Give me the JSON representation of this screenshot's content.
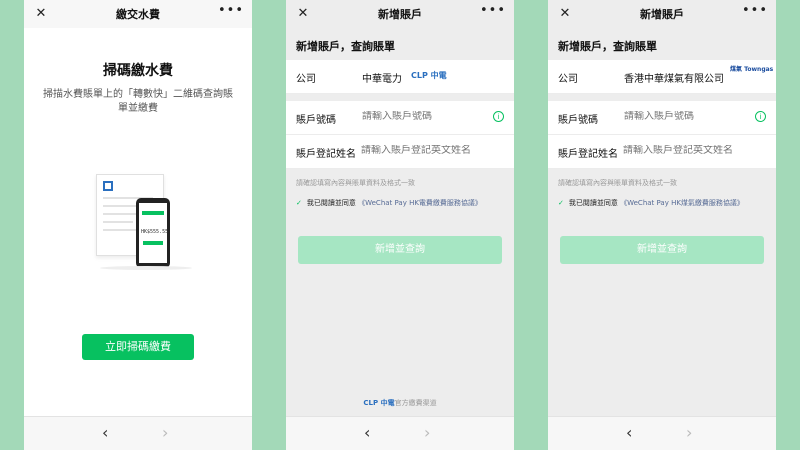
{
  "screen1": {
    "title": "繳交水費",
    "heading": "掃碼繳水費",
    "desc": "掃描水費賬單上的「轉數快」二維碼查詢賬單並繳費",
    "illustration_amount": "HK$555.55",
    "button": "立即掃碼繳費"
  },
  "screen2": {
    "title": "新增賬戶",
    "heading": "新增賬戶，查詢賬單",
    "company_label": "公司",
    "company_value": "中華電力",
    "company_logo": "CLP 中電",
    "account_label": "賬戶號碼",
    "account_placeholder": "請輸入賬戶號碼",
    "name_label": "賬戶登記姓名",
    "name_placeholder": "請輸入賬戶登記英文姓名",
    "note": "請確認填寫內容與賬單資料及格式一致",
    "agree_text": "我已閱讀並同意",
    "agree_link": "《WeChat Pay HK電費繳費服務協議》",
    "submit": "新增並查詢",
    "footer_logo": "CLP 中電",
    "footer_text": "官方繳費渠道"
  },
  "screen3": {
    "title": "新增賬戶",
    "heading": "新增賬戶，查詢賬單",
    "company_label": "公司",
    "company_value": "香港中華煤氣有限公司",
    "company_logo": "煤氣 Towngas",
    "account_label": "賬戶號碼",
    "account_placeholder": "請輸入賬戶號碼",
    "name_label": "賬戶登記姓名",
    "name_placeholder": "請輸入賬戶登記英文姓名",
    "note": "請確認填寫內容與賬單資料及格式一致",
    "agree_text": "我已閱讀並同意",
    "agree_link": "《WeChat Pay HK煤氣繳費服務協議》",
    "submit": "新增並查詢"
  },
  "colors": {
    "accent": "#07c160",
    "accent_disabled": "#a6e6c3",
    "link": "#576b95",
    "background": "#a3d9b8"
  }
}
